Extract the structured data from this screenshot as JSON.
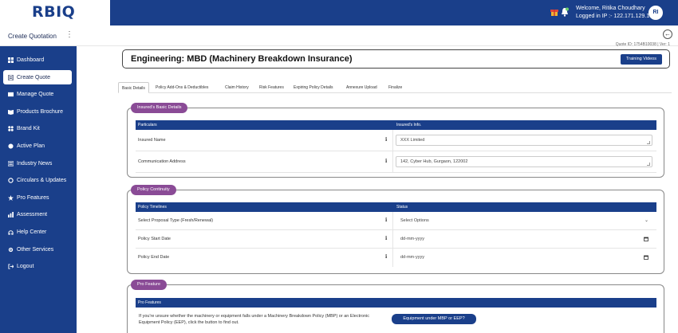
{
  "app": {
    "logo_text": "RBIQ"
  },
  "header": {
    "welcome": "Welcome, Ritika Choudhary",
    "logged_ip": "Logged in IP :- 122.171.129.178",
    "avatar_initials": "RI"
  },
  "subheader": {
    "title": "Create Quotation",
    "quote_id": "Quote ID: 1754B10038 | Ver: 1"
  },
  "sidebar": {
    "items": [
      {
        "label": "Dashboard",
        "icon": "dashboard-icon"
      },
      {
        "label": "Create Quote",
        "icon": "create-quote-icon",
        "active": true
      },
      {
        "label": "Manage Quote",
        "icon": "manage-quote-icon"
      },
      {
        "label": "Products Brochure",
        "icon": "brochure-icon"
      },
      {
        "label": "Brand Kit",
        "icon": "brand-kit-icon"
      },
      {
        "label": "Active Plan",
        "icon": "active-plan-icon"
      },
      {
        "label": "Industry News",
        "icon": "news-icon"
      },
      {
        "label": "Circulars & Updates",
        "icon": "circulars-icon"
      },
      {
        "label": "Pro Features",
        "icon": "pro-features-icon"
      },
      {
        "label": "Assessment",
        "icon": "assessment-icon"
      },
      {
        "label": "Help Center",
        "icon": "help-icon"
      },
      {
        "label": "Other Services",
        "icon": "services-icon"
      },
      {
        "label": "Logout",
        "icon": "logout-icon"
      }
    ]
  },
  "main": {
    "page_title": "Engineering: MBD (Machinery Breakdown Insurance)",
    "training_button": "Training Videos",
    "tabs": [
      {
        "label": "Basic Details",
        "active": true
      },
      {
        "label": "Policy Add-Ons & Deductibles"
      },
      {
        "label": "Claim History"
      },
      {
        "label": "Risk Features"
      },
      {
        "label": "Expiring Policy Details"
      },
      {
        "label": "Annexure Upload"
      },
      {
        "label": "Finalize"
      }
    ],
    "insured": {
      "title": "Insured's Basic Details",
      "col1": "Particulars",
      "col2": "Insured's Info.",
      "rows": [
        {
          "label": "Insured Name",
          "value": "XXX Limited"
        },
        {
          "label": "Communication Address",
          "value": "142, Cyber Hub, Gurgaon, 122002"
        }
      ]
    },
    "continuity": {
      "title": "Policy Continuity",
      "col1": "Policy Timelines",
      "col2": "Status",
      "rows": [
        {
          "label": "Select Proposal Type (Fresh/Renewal)",
          "value": "Select Options"
        },
        {
          "label": "Policy Start Date",
          "value": "dd-mm-yyyy"
        },
        {
          "label": "Policy End Date",
          "value": "dd-mm-yyyy"
        }
      ]
    },
    "pro": {
      "title": "Pro Feature",
      "header": "Pro Features",
      "text_line1": "If you're unsure whether the machinery or equipment falls under a Machinery Breakdown Policy (MBP) or an Electronic",
      "text_line2": "Equipment Policy (EEP), click the button to find out.",
      "button": "Equipment under MBP or EEP?"
    }
  }
}
